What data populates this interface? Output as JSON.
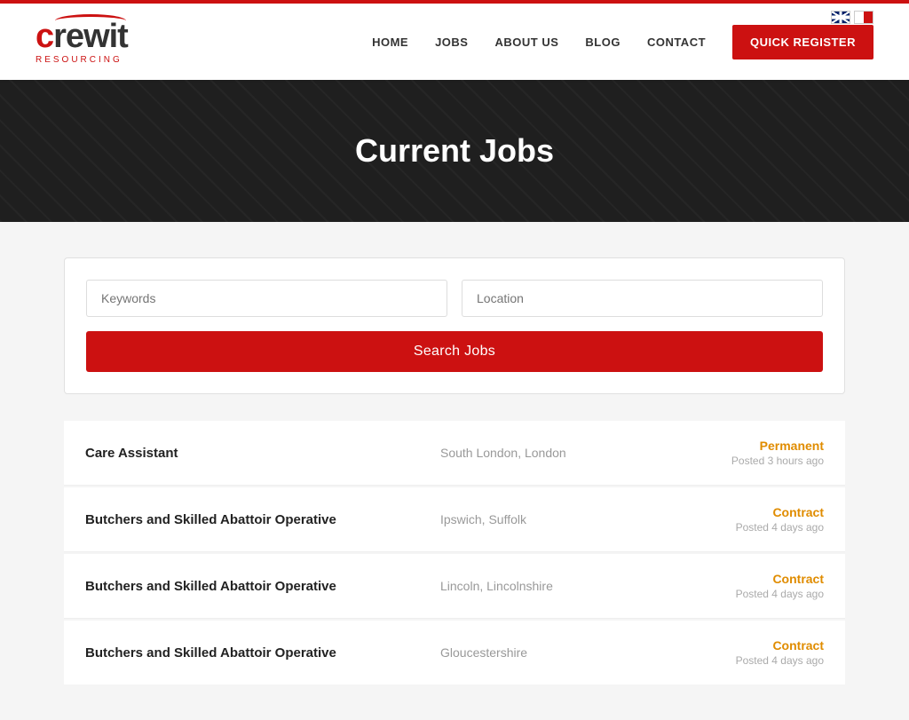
{
  "header": {
    "logo_main": "crewit",
    "logo_sub": "RESOURCING",
    "nav": [
      {
        "label": "HOME",
        "id": "home"
      },
      {
        "label": "JOBS",
        "id": "jobs"
      },
      {
        "label": "ABOUT US",
        "id": "about"
      },
      {
        "label": "BLOG",
        "id": "blog"
      },
      {
        "label": "CONTACT",
        "id": "contact"
      }
    ],
    "quick_register": "QUICK REGISTER"
  },
  "hero": {
    "title": "Current Jobs"
  },
  "search": {
    "keywords_placeholder": "Keywords",
    "location_placeholder": "Location",
    "button_label": "Search Jobs"
  },
  "jobs": [
    {
      "title": "Care Assistant",
      "location": "South London, London",
      "type": "Permanent",
      "posted": "Posted 3 hours ago"
    },
    {
      "title": "Butchers and Skilled Abattoir Operative",
      "location": "Ipswich, Suffolk",
      "type": "Contract",
      "posted": "Posted 4 days ago"
    },
    {
      "title": "Butchers and Skilled Abattoir Operative",
      "location": "Lincoln, Lincolnshire",
      "type": "Contract",
      "posted": "Posted 4 days ago"
    },
    {
      "title": "Butchers and Skilled Abattoir Operative",
      "location": "Gloucestershire",
      "type": "Contract",
      "posted": "Posted 4 days ago"
    }
  ],
  "colors": {
    "accent": "#cc1111",
    "contract_color": "#e08c00",
    "permanent_color": "#e08c00"
  }
}
